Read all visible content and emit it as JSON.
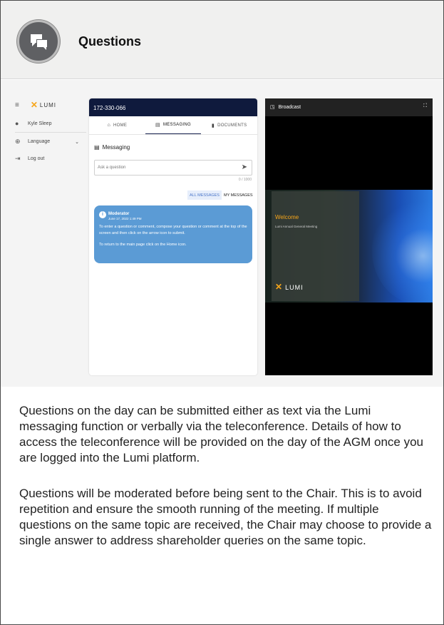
{
  "header": {
    "title": "Questions",
    "icon": "chat-bubbles-icon"
  },
  "sidebar": {
    "menu_icon": "hamburger-icon",
    "logo_text": "LUMI",
    "items": [
      {
        "icon": "user-icon",
        "label": "Kyle Sleep"
      },
      {
        "icon": "globe-icon",
        "label": "Language"
      },
      {
        "icon": "logout-icon",
        "label": "Log out"
      }
    ]
  },
  "messaging_panel": {
    "meeting_id": "172-330-066",
    "tabs": [
      {
        "label": "HOME",
        "icon": "home-icon"
      },
      {
        "label": "MESSAGING",
        "icon": "chat-icon",
        "active": true
      },
      {
        "label": "DOCUMENTS",
        "icon": "document-icon"
      }
    ],
    "title": "Messaging",
    "input_placeholder": "Ask a question",
    "char_counter": "0 / 1000",
    "filters": [
      "ALL MESSAGES",
      "MY MESSAGES"
    ],
    "message": {
      "sender": "Moderator",
      "date": "June 17, 2022 1:49 PM",
      "line1": "To enter a question or comment, compose your question or comment at the top of the screen and then click on the arrow icon to submit.",
      "line2": "To return to the main page click on the Home icon."
    }
  },
  "broadcast_panel": {
    "title": "Broadcast",
    "slide_title": "Welcome",
    "slide_subtitle": "Lumi Annual General Meeting",
    "slide_logo": "LUMI"
  },
  "description": {
    "paragraph1": "Questions on the day can be submitted either as text via the Lumi messaging function or verbally via the teleconference. Details of how to access the teleconference will be provided on the day of the AGM once you are logged into the Lumi platform.",
    "paragraph2": "Questions will be moderated before being sent to the Chair. This is to avoid repetition and ensure the smooth running of the meeting. If multiple questions on the same topic are received, the Chair may choose to provide a single answer to address shareholder queries on the same topic."
  },
  "colors": {
    "accent": "#f6a51a",
    "navy": "#0f1a3d",
    "bubble": "#5b9bd5"
  }
}
